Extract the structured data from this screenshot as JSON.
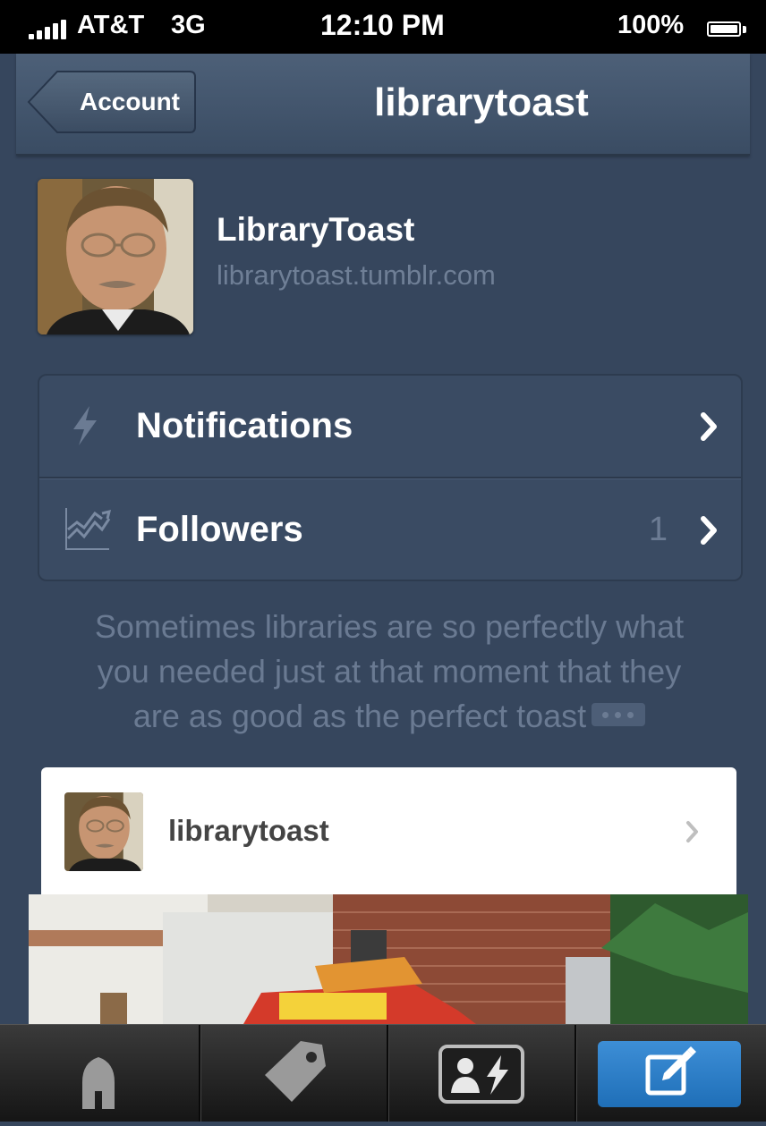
{
  "status_bar": {
    "carrier": "AT&T",
    "network": "3G",
    "time": "12:10 PM",
    "battery": "100%"
  },
  "nav": {
    "back_label": "Account",
    "title": "librarytoast"
  },
  "profile": {
    "name": "LibraryToast",
    "url": "librarytoast.tumblr.com"
  },
  "menu": {
    "notifications_label": "Notifications",
    "followers_label": "Followers",
    "followers_count": "1"
  },
  "description": {
    "line1": "Sometimes libraries are so perfectly what",
    "line2": "you needed just at that moment that they",
    "line3": "are as good as the perfect toast"
  },
  "post": {
    "username": "librarytoast"
  },
  "tabs": [
    {
      "icon": "home-icon"
    },
    {
      "icon": "tag-icon"
    },
    {
      "icon": "activity-icon"
    },
    {
      "icon": "compose-icon"
    }
  ],
  "colors": {
    "background": "#36465d",
    "accent_blue": "#2a7fc9"
  }
}
